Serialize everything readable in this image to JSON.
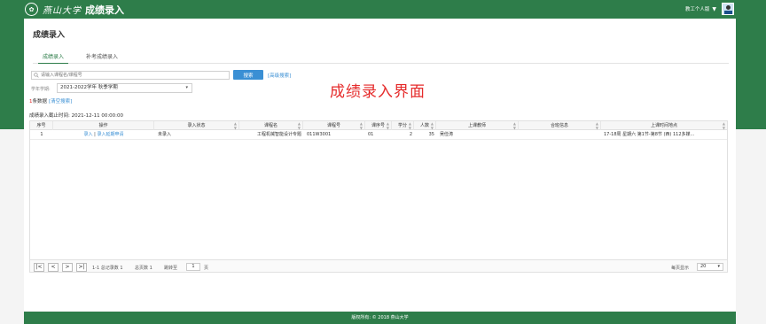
{
  "header": {
    "logo_glyph": "✿",
    "university_name": "燕山大学",
    "app_title": "成绩录入",
    "user_label": "教工个人版",
    "colors": {
      "brand_green": "#2e7d4a",
      "accent_blue": "#3a8fd4",
      "annotation_red": "#e52a2a"
    }
  },
  "page": {
    "title": "成绩录入",
    "tabs": [
      {
        "label": "成绩录入",
        "active": true
      },
      {
        "label": "补考成绩录入",
        "active": false
      }
    ]
  },
  "search": {
    "placeholder": "请输入课程名/课程号",
    "button_label": "搜索",
    "advanced_label": "[高级搜索]"
  },
  "term": {
    "label": "学年学期:",
    "value": "2021-2022学年 秋季学期"
  },
  "records": {
    "count": "1",
    "count_suffix": "条数据",
    "clear_label": "[清空搜索]"
  },
  "annotation": "成绩录入界面",
  "deadline": {
    "label": "成绩录入截止时间:",
    "value": "2021-12-11 00:00:00"
  },
  "table": {
    "columns": [
      "序号",
      "操作",
      "录入状态",
      "课程名",
      "课程号",
      "课序号",
      "学分",
      "人数",
      "上课教师",
      "合班信息",
      "上课时间地点"
    ],
    "rows": [
      {
        "index": "1",
        "action_enter": "录入",
        "action_sep": " | ",
        "action_extend": "录入延期申请",
        "status": "未录入",
        "course_name": "工程机械智能设计专题",
        "course_no": "011W3001",
        "section": "01",
        "credits": "2",
        "students": "35",
        "teacher": "吴俭涛",
        "merged": "",
        "time_place": "17-18周 星期六 第1节-第8节 (西) 112多媒..."
      }
    ]
  },
  "pager": {
    "first": "|<",
    "prev": "<",
    "next": ">",
    "last": ">|",
    "range_text": "1-1 总记录数 1",
    "total_pages_text": "总页数 1",
    "goto_label": "跳转至",
    "page_value": "1",
    "page_unit": "页",
    "per_page_label": "每页显示",
    "per_page_value": "20"
  },
  "footer": {
    "text": "版权所有: © 2018 燕山大学"
  }
}
